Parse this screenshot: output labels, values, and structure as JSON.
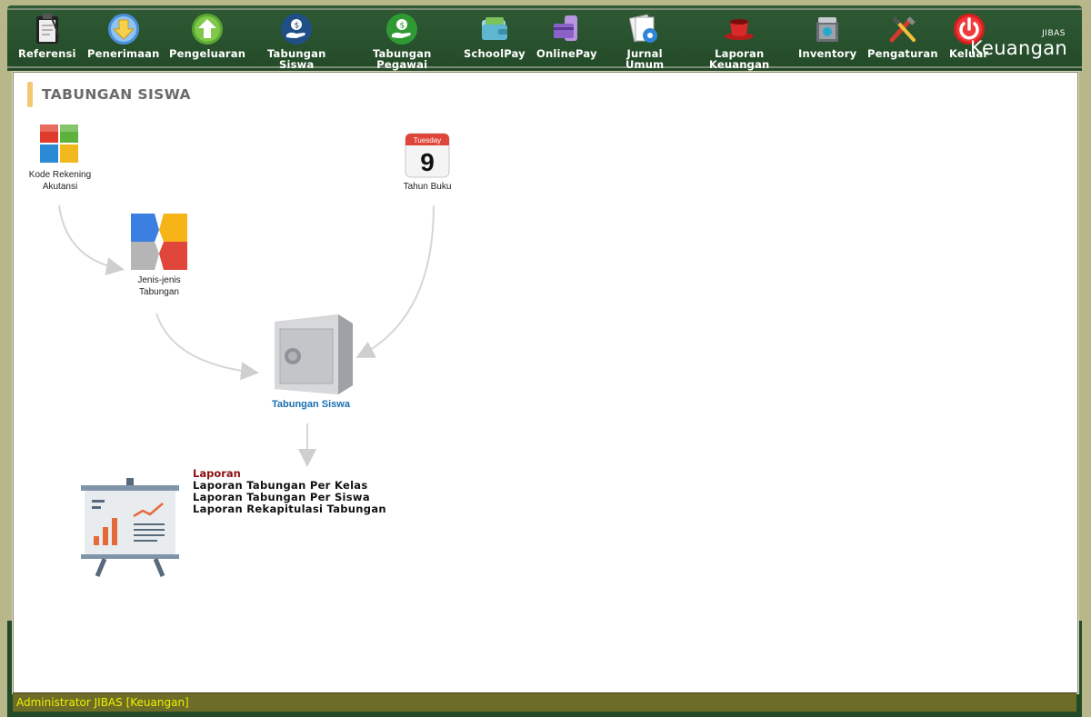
{
  "nav": {
    "items": [
      {
        "label": "Referensi",
        "icon": "clipboard-icon"
      },
      {
        "label": "Penerimaan",
        "icon": "arrow-down-circle-icon"
      },
      {
        "label": "Pengeluaran",
        "icon": "arrow-up-circle-icon"
      },
      {
        "label": "Tabungan\nSiswa",
        "icon": "hand-money-blue-icon"
      },
      {
        "label": "Tabungan\nPegawai",
        "icon": "hand-money-green-icon"
      },
      {
        "label": "SchoolPay",
        "icon": "wallet-icon"
      },
      {
        "label": "OnlinePay",
        "icon": "card-phone-icon"
      },
      {
        "label": "Jurnal\nUmum",
        "icon": "journal-gear-icon"
      },
      {
        "label": "Laporan\nKeuangan",
        "icon": "red-cup-icon"
      },
      {
        "label": "Inventory",
        "icon": "inventory-box-icon"
      },
      {
        "label": "Pengaturan",
        "icon": "tools-icon"
      },
      {
        "label": "Keluar",
        "icon": "power-icon"
      }
    ]
  },
  "brand": {
    "small": "JIBAS",
    "big": "Keuangan"
  },
  "page": {
    "title": "TABUNGAN SISWA"
  },
  "diagram": {
    "kode_rekening": "Kode Rekening\nAkutansi",
    "jenis_tabungan": "Jenis-jenis\nTabungan",
    "tahun_buku": "Tahun Buku",
    "calendar_day": "Tuesday",
    "calendar_date": "9",
    "tabungan_siswa": "Tabungan Siswa"
  },
  "reports": {
    "header": "Laporan",
    "links": [
      "Laporan Tabungan Per Kelas",
      "Laporan Tabungan Per Siswa",
      "Laporan Rekapitulasi Tabungan"
    ]
  },
  "status": {
    "text": "Administrator JIBAS [Keuangan]"
  },
  "colors": {
    "nav_bg": "#2f5a34",
    "title_accent": "#f4c873",
    "link_blue": "#1a6fb0",
    "report_header": "#8b0f12",
    "status_text": "#f0f000"
  }
}
